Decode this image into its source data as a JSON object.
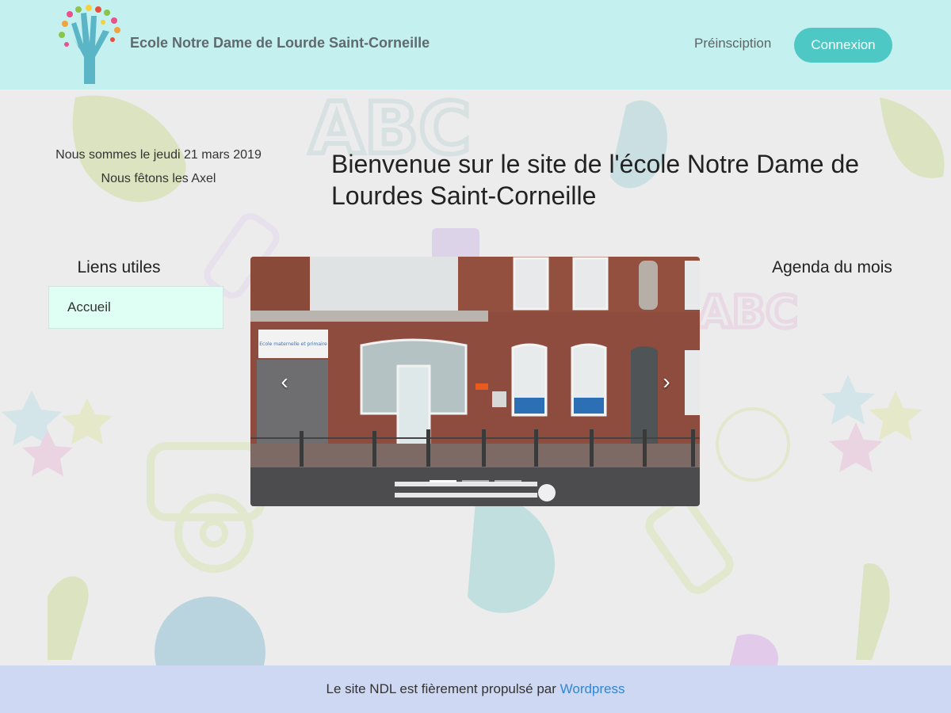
{
  "header": {
    "site_title": "Ecole Notre Dame de Lourde Saint-Corneille",
    "nav_link": "Préinsciption",
    "login_label": "Connexion",
    "logo_icon": "hand-tree-logo-icon"
  },
  "info": {
    "date_line": "Nous sommes le jeudi 21 mars 2019",
    "name_day": "Nous fêtons les Axel"
  },
  "main": {
    "title": "Bienvenue sur le site de l'école Notre Dame de Lourdes Saint-Corneille"
  },
  "sidebar_left": {
    "title": "Liens utiles",
    "items": [
      {
        "label": "Accueil"
      }
    ]
  },
  "sidebar_right": {
    "title": "Agenda du mois"
  },
  "carousel": {
    "prev_icon": "chevron-left-icon",
    "next_icon": "chevron-right-icon",
    "prev_glyph": "‹",
    "next_glyph": "›",
    "slide_count": 3,
    "active_slide": 1,
    "photo_sign_text": "Ecole maternelle et primaire"
  },
  "footer": {
    "text": "Le site NDL est fièrement propulsé par",
    "link_label": "Wordpress"
  },
  "colors": {
    "header_bg": "#c5f0f0",
    "accent": "#4dc8c4",
    "footer_bg": "#cfd8f2",
    "link": "#2f86d6"
  }
}
